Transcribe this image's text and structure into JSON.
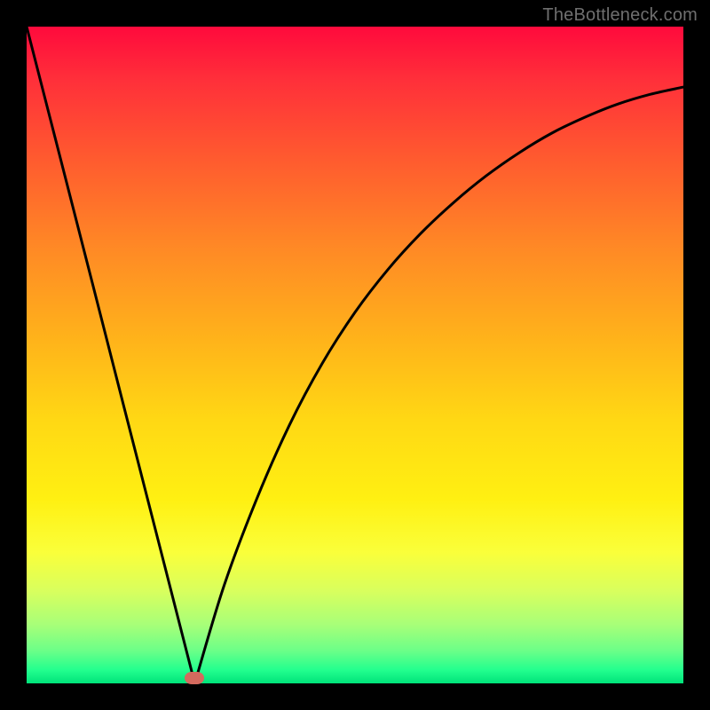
{
  "watermark": "TheBottleneck.com",
  "marker": {
    "x_frac": 0.256,
    "y_frac": 0.992,
    "color": "#d46a5e"
  },
  "chart_data": {
    "type": "line",
    "title": "",
    "xlabel": "",
    "ylabel": "",
    "xlim": [
      0,
      1
    ],
    "ylim": [
      0,
      1
    ],
    "grid": false,
    "legend": false,
    "annotations": [
      "TheBottleneck.com"
    ],
    "series": [
      {
        "name": "bottleneck-curve",
        "x": [
          0.0,
          0.05,
          0.1,
          0.15,
          0.2,
          0.256,
          0.3,
          0.35,
          0.4,
          0.45,
          0.5,
          0.55,
          0.6,
          0.65,
          0.7,
          0.75,
          0.8,
          0.85,
          0.9,
          0.95,
          1.0
        ],
        "y": [
          1.0,
          0.805,
          0.61,
          0.414,
          0.219,
          0.0,
          0.147,
          0.28,
          0.393,
          0.487,
          0.565,
          0.63,
          0.685,
          0.732,
          0.773,
          0.808,
          0.838,
          0.862,
          0.882,
          0.897,
          0.908
        ]
      }
    ],
    "note": "x,y are normalized 0..1; y=0 at bottom (green), y=1 at top (red). Minimum at x≈0.256."
  }
}
